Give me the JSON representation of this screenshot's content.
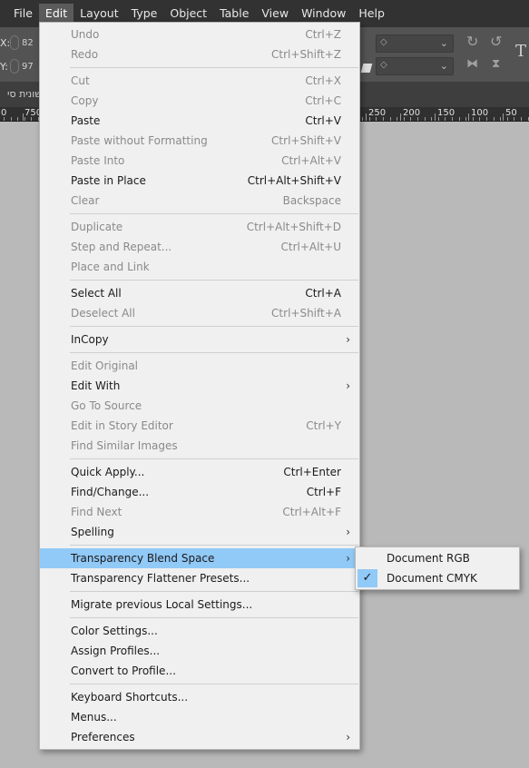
{
  "menubar": {
    "items": [
      "File",
      "Edit",
      "Layout",
      "Type",
      "Object",
      "Table",
      "View",
      "Window",
      "Help"
    ],
    "active": "Edit"
  },
  "controlbar": {
    "x_label": "X:",
    "x_value": "82",
    "y_label": "Y:",
    "y_value": "97"
  },
  "panelstrip": {
    "text": "שונית סי"
  },
  "ruler": {
    "left_labels": [
      "0",
      "750"
    ],
    "right_labels": [
      "250",
      "200",
      "150",
      "100",
      "50"
    ]
  },
  "edit_menu": {
    "items": [
      {
        "label": "Undo",
        "shortcut": "Ctrl+Z",
        "enabled": false
      },
      {
        "label": "Redo",
        "shortcut": "Ctrl+Shift+Z",
        "enabled": false
      },
      {
        "sep": true
      },
      {
        "label": "Cut",
        "shortcut": "Ctrl+X",
        "enabled": false
      },
      {
        "label": "Copy",
        "shortcut": "Ctrl+C",
        "enabled": false
      },
      {
        "label": "Paste",
        "shortcut": "Ctrl+V",
        "enabled": true
      },
      {
        "label": "Paste without Formatting",
        "shortcut": "Ctrl+Shift+V",
        "enabled": false
      },
      {
        "label": "Paste Into",
        "shortcut": "Ctrl+Alt+V",
        "enabled": false
      },
      {
        "label": "Paste in Place",
        "shortcut": "Ctrl+Alt+Shift+V",
        "enabled": true
      },
      {
        "label": "Clear",
        "shortcut": "Backspace",
        "enabled": false
      },
      {
        "sep": true
      },
      {
        "label": "Duplicate",
        "shortcut": "Ctrl+Alt+Shift+D",
        "enabled": false
      },
      {
        "label": "Step and Repeat...",
        "shortcut": "Ctrl+Alt+U",
        "enabled": false
      },
      {
        "label": "Place and Link",
        "shortcut": "",
        "enabled": false
      },
      {
        "sep": true
      },
      {
        "label": "Select All",
        "shortcut": "Ctrl+A",
        "enabled": true
      },
      {
        "label": "Deselect All",
        "shortcut": "Ctrl+Shift+A",
        "enabled": false
      },
      {
        "sep": true
      },
      {
        "label": "InCopy",
        "shortcut": "",
        "enabled": true,
        "submenu": true
      },
      {
        "sep": true
      },
      {
        "label": "Edit Original",
        "shortcut": "",
        "enabled": false
      },
      {
        "label": "Edit With",
        "shortcut": "",
        "enabled": true,
        "submenu": true
      },
      {
        "label": "Go To Source",
        "shortcut": "",
        "enabled": false
      },
      {
        "label": "Edit in Story Editor",
        "shortcut": "Ctrl+Y",
        "enabled": false
      },
      {
        "label": "Find Similar Images",
        "shortcut": "",
        "enabled": false
      },
      {
        "sep": true
      },
      {
        "label": "Quick Apply...",
        "shortcut": "Ctrl+Enter",
        "enabled": true
      },
      {
        "label": "Find/Change...",
        "shortcut": "Ctrl+F",
        "enabled": true
      },
      {
        "label": "Find Next",
        "shortcut": "Ctrl+Alt+F",
        "enabled": false
      },
      {
        "label": "Spelling",
        "shortcut": "",
        "enabled": true,
        "submenu": true
      },
      {
        "sep": true
      },
      {
        "label": "Transparency Blend Space",
        "shortcut": "",
        "enabled": true,
        "submenu": true,
        "highlighted": true
      },
      {
        "label": "Transparency Flattener Presets...",
        "shortcut": "",
        "enabled": true
      },
      {
        "sep": true
      },
      {
        "label": "Migrate previous Local Settings...",
        "shortcut": "",
        "enabled": true
      },
      {
        "sep": true
      },
      {
        "label": "Color Settings...",
        "shortcut": "",
        "enabled": true
      },
      {
        "label": "Assign Profiles...",
        "shortcut": "",
        "enabled": true
      },
      {
        "label": "Convert to Profile...",
        "shortcut": "",
        "enabled": true
      },
      {
        "sep": true
      },
      {
        "label": "Keyboard Shortcuts...",
        "shortcut": "",
        "enabled": true
      },
      {
        "label": "Menus...",
        "shortcut": "",
        "enabled": true
      },
      {
        "label": "Preferences",
        "shortcut": "",
        "enabled": true,
        "submenu": true
      }
    ]
  },
  "blend_space_submenu": {
    "items": [
      {
        "label": "Document RGB",
        "checked": false
      },
      {
        "label": "Document CMYK",
        "checked": true
      }
    ]
  },
  "colors": {
    "menubar_bg": "#323232",
    "menu_bg": "#f0f0f0",
    "highlight": "#91c9f7",
    "canvas_bg": "#b9b9b9"
  }
}
